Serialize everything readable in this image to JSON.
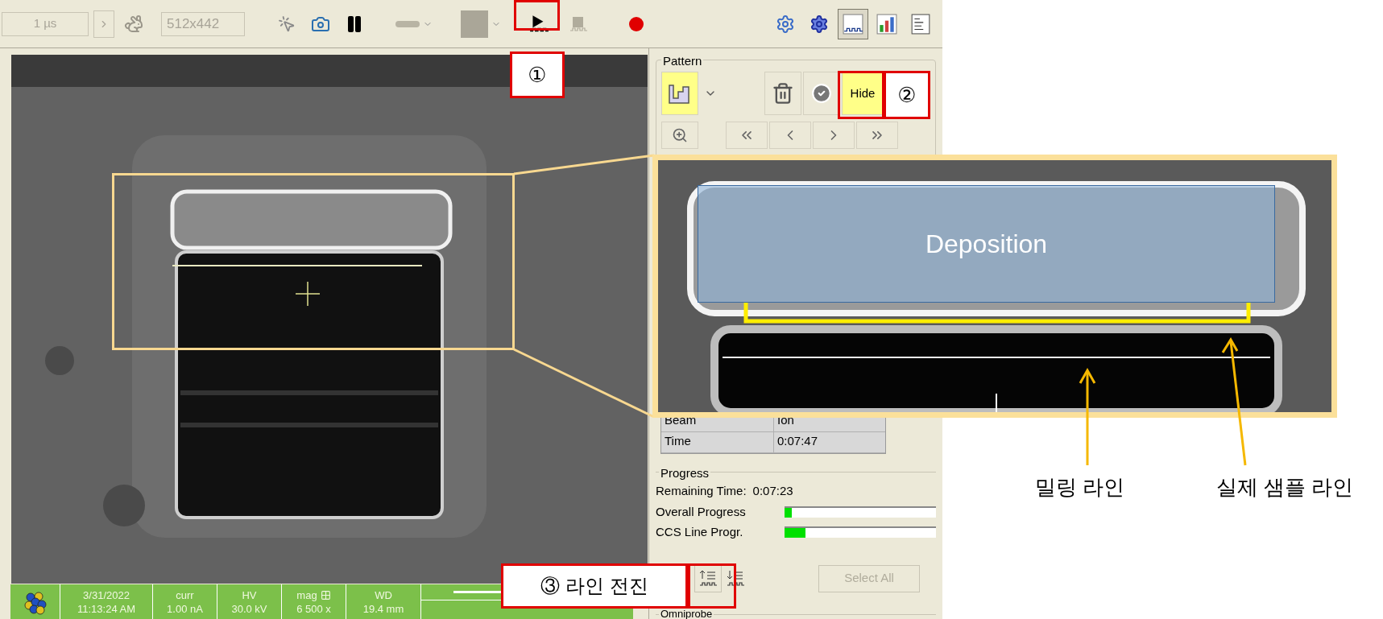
{
  "toolbar": {
    "dwell": "1 µs",
    "resolution": "512x442",
    "view_buttons": [
      {
        "selected": false
      },
      {
        "selected": false
      },
      {
        "selected": true
      },
      {
        "selected": false
      },
      {
        "selected": false
      }
    ]
  },
  "callouts": {
    "play": "①",
    "hide": "②",
    "line_advance": "③ 라인 전진"
  },
  "pattern": {
    "title": "Pattern",
    "stencil_active": true,
    "hide_button": {
      "label": "Hide",
      "active": true
    }
  },
  "properties": [
    {
      "label": "Beam",
      "value": "Ion"
    },
    {
      "label": "Time",
      "value": "0:07:47"
    }
  ],
  "progress": {
    "title": "Progress",
    "remaining_label": "Remaining Time:",
    "remaining_value": "0:07:23",
    "bars": [
      {
        "label": "Overall Progress",
        "level": 0.05
      },
      {
        "label": "CCS Line Progr.",
        "level": 0.14
      }
    ]
  },
  "select_all": {
    "label": "Select All",
    "disabled": true
  },
  "omniprobe": "Omniprobe",
  "status_bar": [
    {
      "label": "3/31/2022",
      "value": "11:13:24 AM",
      "kind": "text"
    },
    {
      "label": "curr",
      "value": "1.00 nA",
      "kind": "text"
    },
    {
      "label": "HV",
      "value": "30.0 kV",
      "kind": "text"
    },
    {
      "label": "mag",
      "value": "6 500 x",
      "kind": "grid"
    },
    {
      "label": "WD",
      "value": "19.4 mm",
      "kind": "text"
    }
  ],
  "inset": {
    "label": "Deposition"
  },
  "annotations": [
    "밀링 라인",
    "실제 샘플 라인"
  ]
}
